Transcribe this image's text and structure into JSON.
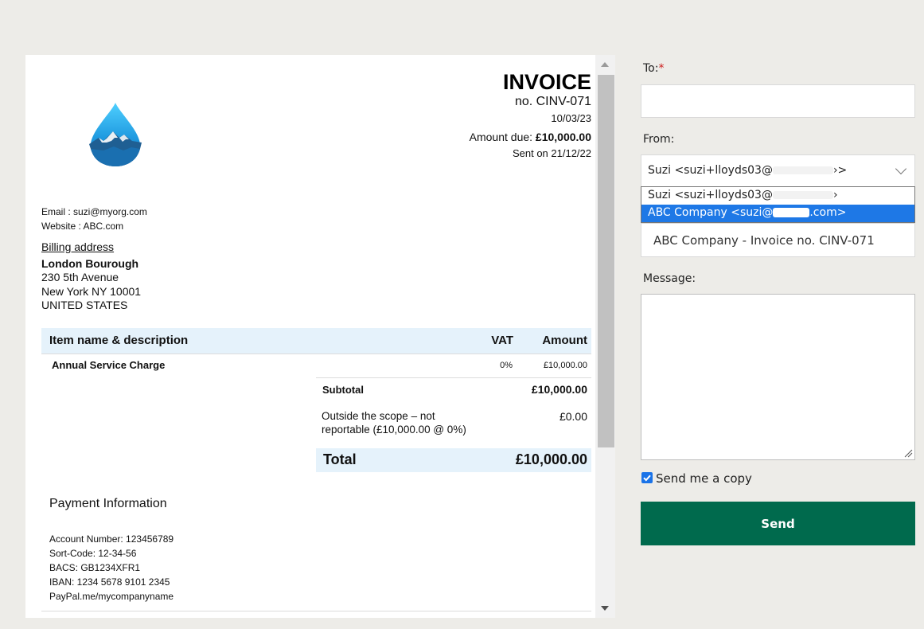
{
  "invoice": {
    "title": "INVOICE",
    "number": "no. CINV-071",
    "date": "10/03/23",
    "amount_due_label": "Amount due:",
    "amount_due_value": "£10,000.00",
    "sent_on": "Sent on 21/12/22",
    "email": "Email : suzi@myorg.com",
    "website": "Website : ABC.com",
    "billing_label": "Billing address",
    "billing_name": "London Bourough",
    "billing_lines": [
      "230 5th Avenue",
      "New York NY 10001",
      "UNITED STATES"
    ],
    "table": {
      "headers": {
        "item": "Item name & description",
        "vat": "VAT",
        "amount": "Amount"
      },
      "rows": [
        {
          "name": "Annual Service Charge",
          "vat": "0%",
          "amount": "£10,000.00"
        }
      ],
      "subtotal_label": "Subtotal",
      "subtotal_value": "£10,000.00",
      "scope_label": "Outside the scope – not reportable (£10,000.00 @ 0%)",
      "scope_value": "£0.00",
      "total_label": "Total",
      "total_value": "£10,000.00"
    },
    "payment": {
      "title": "Payment Information",
      "lines": [
        "Account Number: 123456789",
        "Sort-Code: 12-34-56",
        "BACS: GB1234XFR1",
        "IBAN: 1234 5678 9101 2345",
        "PayPal.me/mycompanyname"
      ]
    },
    "logo_icon": "water-drop-mountain-icon",
    "logo_colors": {
      "top": "#29b6f6",
      "bottom": "#0d5fa8"
    }
  },
  "form": {
    "to_label": "To:",
    "to_required": "*",
    "to_value": "",
    "from_label": "From:",
    "from_value_start": "Suzi <suzi+lloyds03@",
    "from_value_end": "›>",
    "from_options": [
      {
        "start": "Suzi <suzi+lloyds03@",
        "end": "›"
      },
      {
        "start": "ABC Company <suzi@",
        "end": ".com>"
      }
    ],
    "subject_value": "ABC Company - Invoice no. CINV-071",
    "message_label": "Message:",
    "message_value": "",
    "copy_label": "Send me a copy",
    "copy_checked": true,
    "send_label": "Send",
    "colors": {
      "send_button": "#006a4d",
      "selected_option": "#1e78e6",
      "required": "#cc1d1d"
    }
  }
}
